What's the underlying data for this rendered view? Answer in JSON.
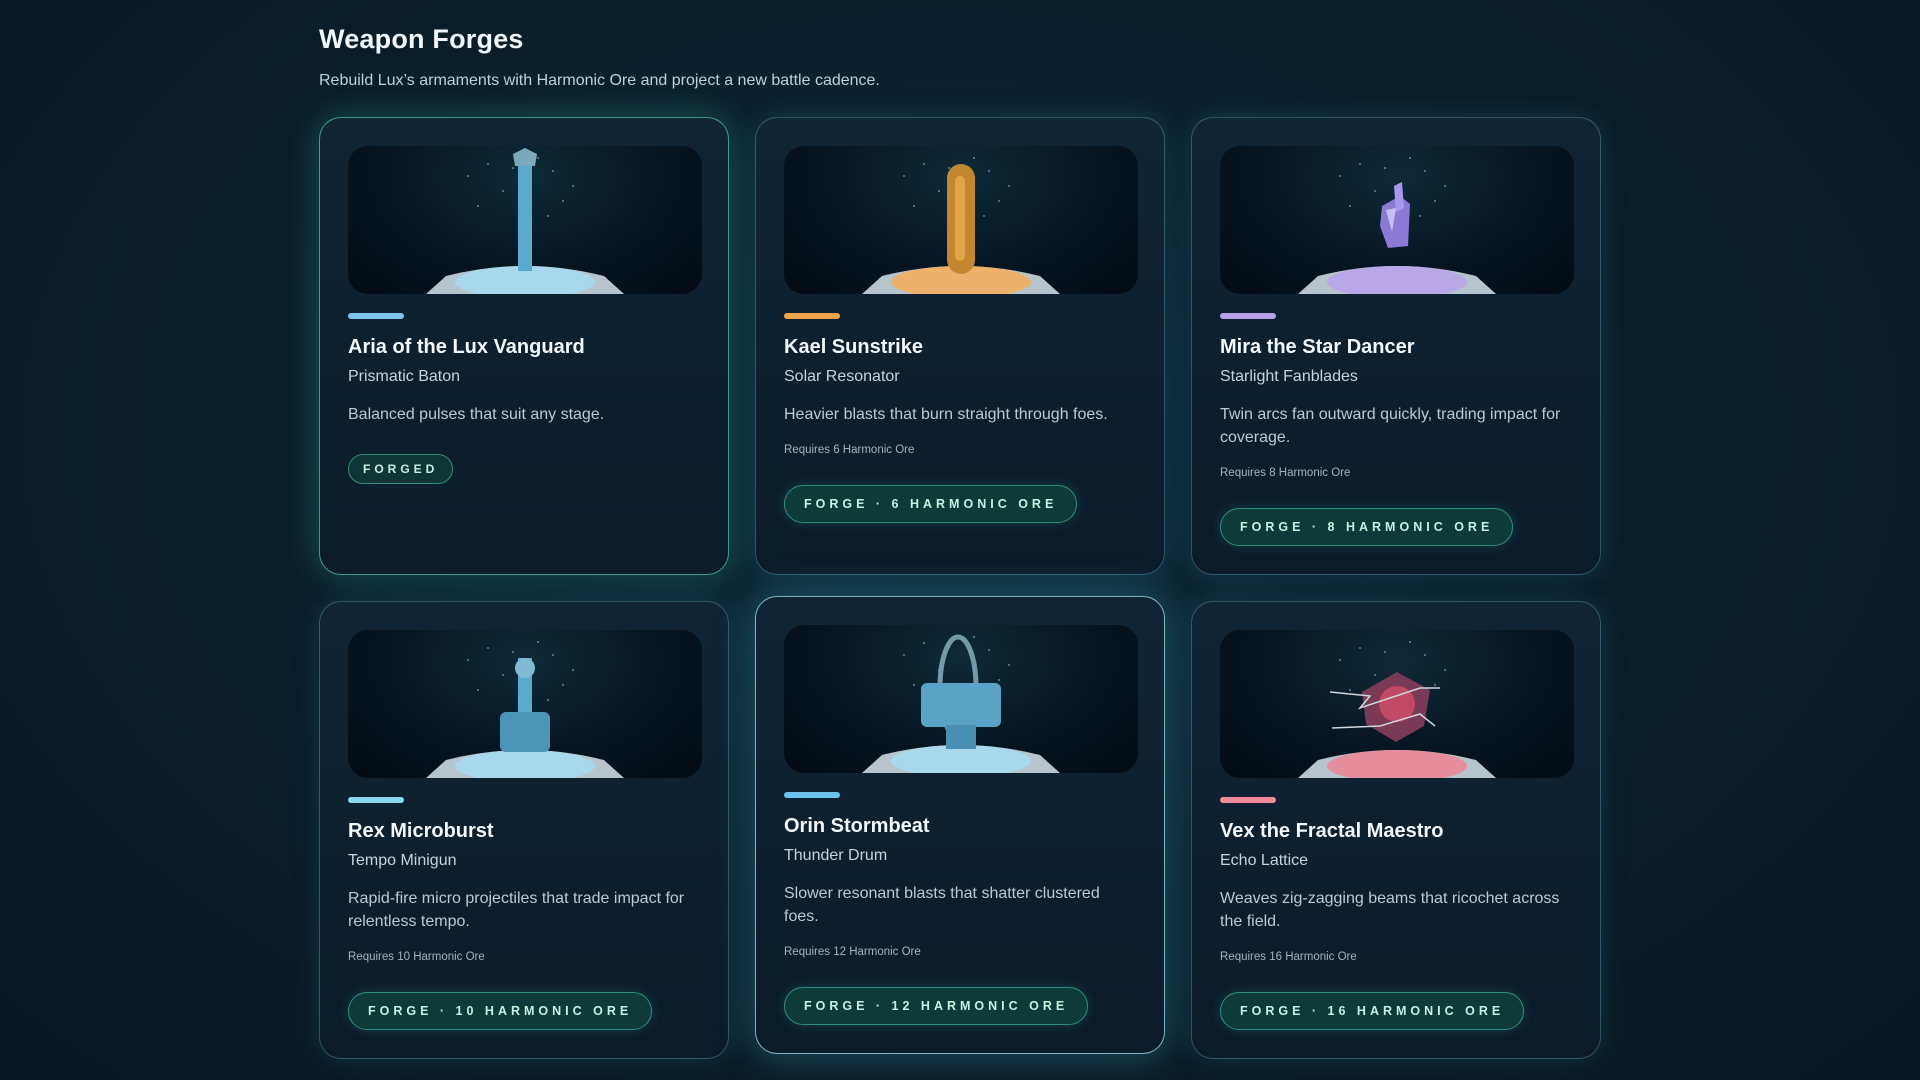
{
  "header": {
    "title": "Weapon Forges",
    "subtitle": "Rebuild Lux’s armaments with Harmonic Ore and project a new battle cadence."
  },
  "cards": [
    {
      "hero": "Aria of the Lux Vanguard",
      "weapon": "Prismatic Baton",
      "description": "Balanced pulses that suit any stage.",
      "status": "FORGED",
      "accent": "#7cc6ea",
      "icon": "baton-icon"
    },
    {
      "hero": "Kael Sunstrike",
      "weapon": "Solar Resonator",
      "description": "Heavier blasts that burn straight through foes.",
      "requirement": "Requires 6 Harmonic Ore",
      "button": "FORGE · 6 HARMONIC ORE",
      "accent": "#f0a44a",
      "icon": "resonator-icon"
    },
    {
      "hero": "Mira the Star Dancer",
      "weapon": "Starlight Fanblades",
      "description": "Twin arcs fan outward quickly, trading impact for coverage.",
      "requirement": "Requires 8 Harmonic Ore",
      "button": "FORGE · 8 HARMONIC ORE",
      "accent": "#b8a2ea",
      "icon": "fanblades-icon"
    },
    {
      "hero": "Rex Microburst",
      "weapon": "Tempo Minigun",
      "description": "Rapid-fire micro projectiles that trade impact for relentless tempo.",
      "requirement": "Requires 10 Harmonic Ore",
      "button": "FORGE · 10 HARMONIC ORE",
      "accent": "#86d8ec",
      "icon": "minigun-icon"
    },
    {
      "hero": "Orin Stormbeat",
      "weapon": "Thunder Drum",
      "description": "Slower resonant blasts that shatter clustered foes.",
      "requirement": "Requires 12 Harmonic Ore",
      "button": "FORGE · 12 HARMONIC ORE",
      "accent": "#6cc4ec",
      "icon": "drum-icon"
    },
    {
      "hero": "Vex the Fractal Maestro",
      "weapon": "Echo Lattice",
      "description": "Weaves zig-zagging beams that ricochet across the field.",
      "requirement": "Requires 16 Harmonic Ore",
      "button": "FORGE · 16 HARMONIC ORE",
      "accent": "#f08a98",
      "icon": "lattice-icon"
    }
  ]
}
